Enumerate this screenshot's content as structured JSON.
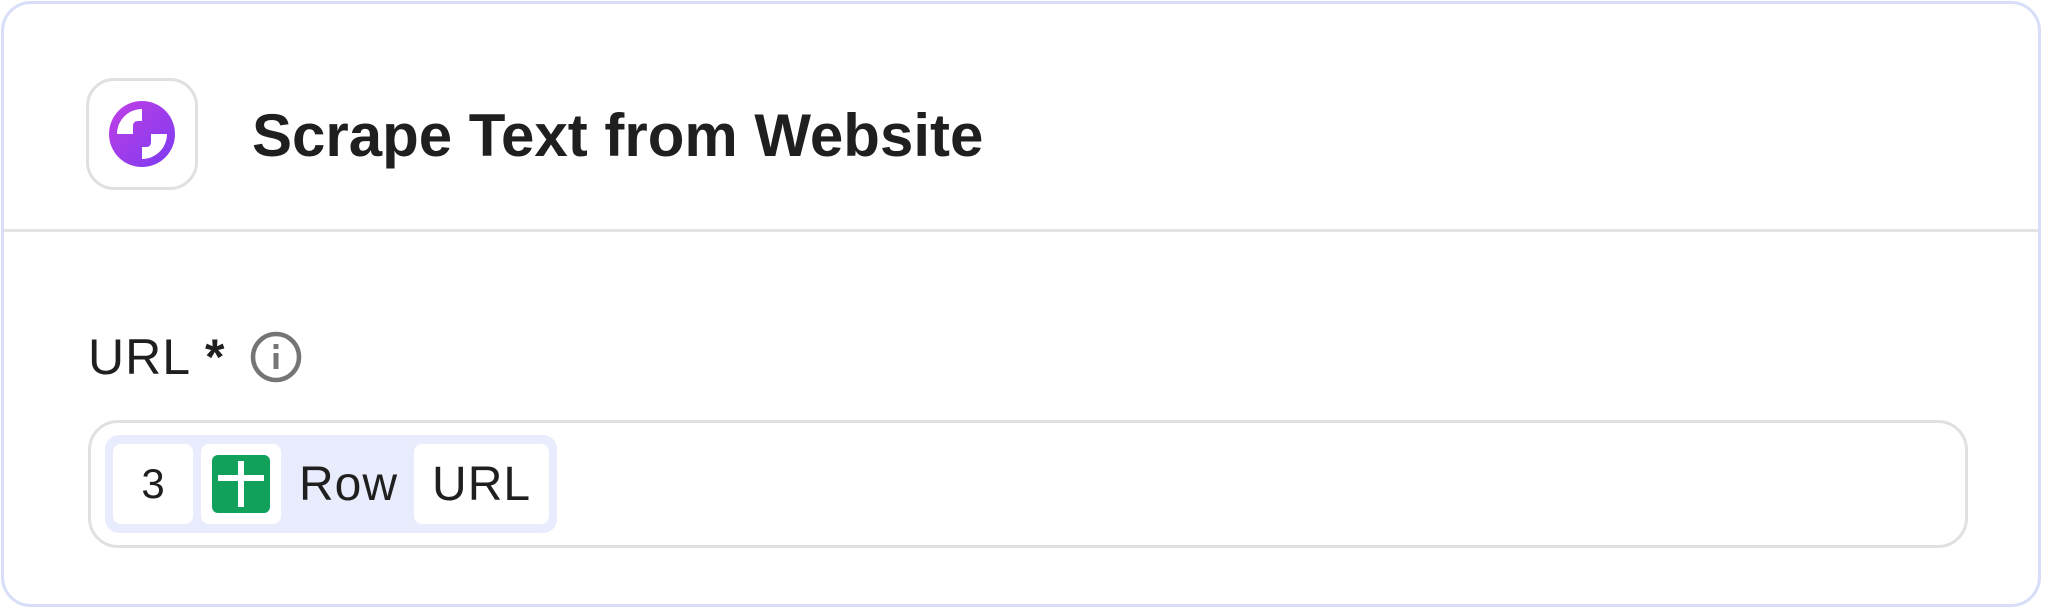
{
  "header": {
    "title": "Scrape Text from Website",
    "app_icon": "scraper-app-icon",
    "colors": {
      "icon_gradient_start": "#c13ee6",
      "icon_gradient_end": "#7b3cf0"
    }
  },
  "field": {
    "label": "URL",
    "required_mark": "*",
    "info_icon": "info-icon",
    "value_token": {
      "step_number": "3",
      "source_icon": "google-sheets-icon",
      "source_text": "Row",
      "value": "URL",
      "colors": {
        "token_bg": "#e8ecfd",
        "sheets_green": "#12a15b"
      }
    }
  },
  "colors": {
    "card_border": "#d8defa",
    "divider": "#e3e3e3",
    "text": "#1f1f1f"
  }
}
